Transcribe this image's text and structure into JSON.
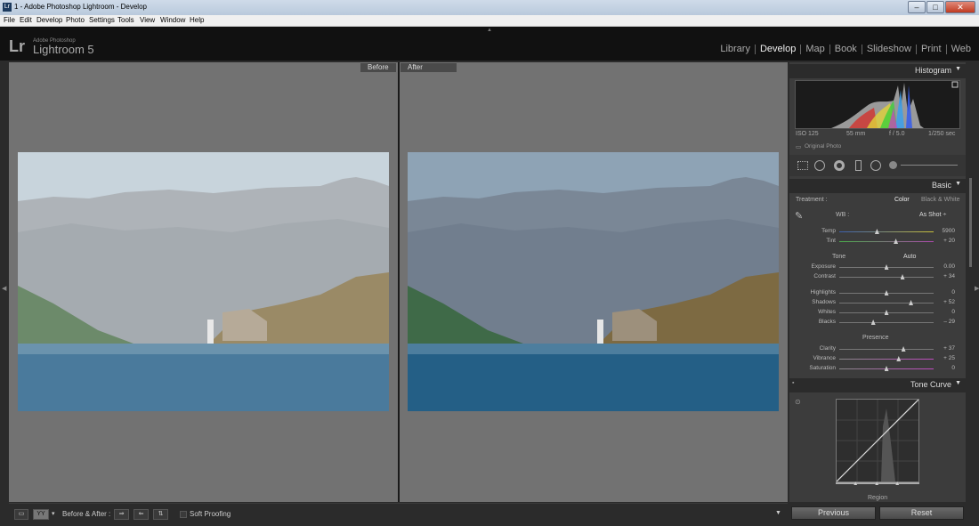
{
  "window": {
    "title": "1 - Adobe Photoshop Lightroom - Develop",
    "min": "–",
    "max": "□",
    "close": "✕",
    "icon": "Lr"
  },
  "menu": [
    "File",
    "Edit",
    "Develop",
    "Photo",
    "Settings",
    "Tools",
    "View",
    "Window",
    "Help"
  ],
  "app": {
    "brand_mark": "Lr",
    "brand_sub": "Adobe Photoshop",
    "brand_name": "Lightroom 5"
  },
  "modules": [
    {
      "label": "Library",
      "active": false
    },
    {
      "label": "Develop",
      "active": true
    },
    {
      "label": "Map",
      "active": false
    },
    {
      "label": "Book",
      "active": false
    },
    {
      "label": "Slideshow",
      "active": false
    },
    {
      "label": "Print",
      "active": false
    },
    {
      "label": "Web",
      "active": false
    }
  ],
  "views": {
    "before": "Before",
    "after": "After"
  },
  "toolbar": {
    "before_after_label": "Before & After :",
    "soft_proofing": "Soft Proofing",
    "yy": "YY"
  },
  "histogram": {
    "title": "Histogram",
    "iso": "ISO 125",
    "focal": "55 mm",
    "aperture": "f / 5.0",
    "shutter": "1/250 sec",
    "original": "Original Photo"
  },
  "basic": {
    "title": "Basic",
    "treatment_label": "Treatment :",
    "color": "Color",
    "bw": "Black & White",
    "wb_label": "WB :",
    "wb_value": "As Shot ÷",
    "tone_label": "Tone",
    "auto_label": "Auto",
    "presence_label": "Presence",
    "sliders": {
      "temp": {
        "label": "Temp",
        "value": "5900",
        "pos": 0.4
      },
      "tint": {
        "label": "Tint",
        "value": "+ 20",
        "pos": 0.6
      },
      "exposure": {
        "label": "Exposure",
        "value": "0.00",
        "pos": 0.5
      },
      "contrast": {
        "label": "Contrast",
        "value": "+ 34",
        "pos": 0.67
      },
      "highlights": {
        "label": "Highlights",
        "value": "0",
        "pos": 0.5
      },
      "shadows": {
        "label": "Shadows",
        "value": "+ 52",
        "pos": 0.76
      },
      "whites": {
        "label": "Whites",
        "value": "0",
        "pos": 0.5
      },
      "blacks": {
        "label": "Blacks",
        "value": "– 29",
        "pos": 0.36
      },
      "clarity": {
        "label": "Clarity",
        "value": "+ 37",
        "pos": 0.68
      },
      "vibrance": {
        "label": "Vibrance",
        "value": "+ 25",
        "pos": 0.63
      },
      "saturation": {
        "label": "Saturation",
        "value": "0",
        "pos": 0.5
      }
    }
  },
  "tone_curve": {
    "title": "Tone Curve",
    "region": "Region"
  },
  "buttons": {
    "previous": "Previous",
    "reset": "Reset"
  },
  "colors": {
    "panel_bg": "#3c3c3c",
    "work_bg": "#727272",
    "topbar": "#111111"
  }
}
